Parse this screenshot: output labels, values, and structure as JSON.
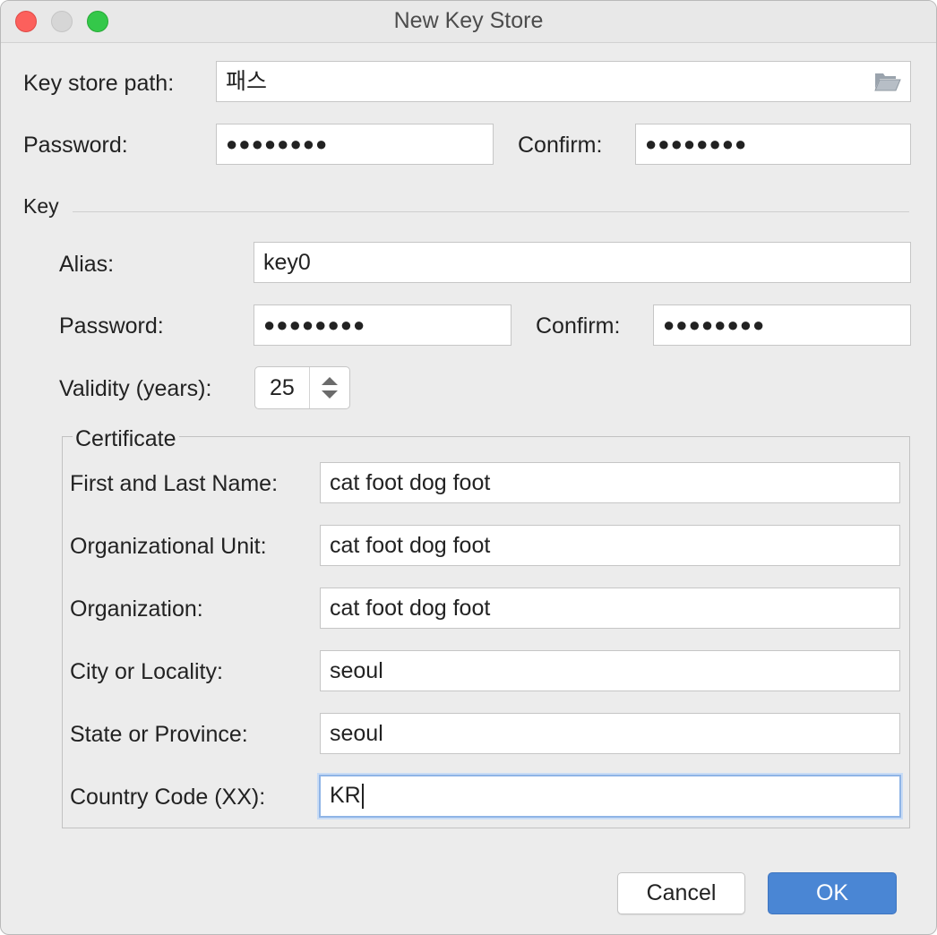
{
  "window": {
    "title": "New Key Store"
  },
  "keystore": {
    "path_label": "Key store path:",
    "path_value": "패스",
    "password_label": "Password:",
    "password_value": "●●●●●●●●",
    "confirm_label": "Confirm:",
    "confirm_value": "●●●●●●●●"
  },
  "key": {
    "section_label": "Key",
    "alias_label": "Alias:",
    "alias_value": "key0",
    "password_label": "Password:",
    "password_value": "●●●●●●●●",
    "confirm_label": "Confirm:",
    "confirm_value": "●●●●●●●●",
    "validity_label": "Validity (years):",
    "validity_value": "25"
  },
  "certificate": {
    "title": "Certificate",
    "fields": [
      {
        "label": "First and Last Name:",
        "value": "cat foot dog foot"
      },
      {
        "label": "Organizational Unit:",
        "value": "cat foot dog foot"
      },
      {
        "label": "Organization:",
        "value": "cat foot dog foot"
      },
      {
        "label": "City or Locality:",
        "value": "seoul"
      },
      {
        "label": "State or Province:",
        "value": "seoul"
      },
      {
        "label": "Country Code (XX):",
        "value": "KR"
      }
    ]
  },
  "buttons": {
    "cancel": "Cancel",
    "ok": "OK"
  },
  "colors": {
    "accent": "#4a86d4",
    "window_bg": "#ececec",
    "focus_ring": "#8fb4e6"
  },
  "icons": {
    "browse": "folder-open-icon",
    "spinner": "up-down-arrows-icon"
  }
}
